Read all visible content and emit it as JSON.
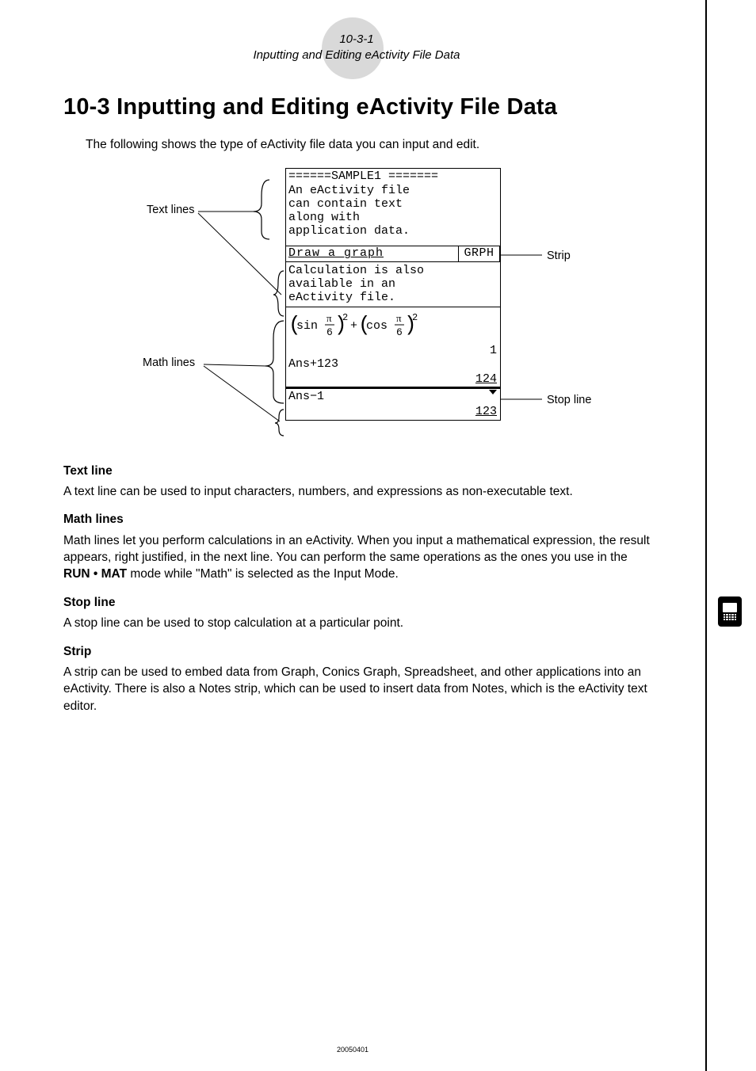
{
  "header": {
    "pageno": "10-3-1",
    "ptitle": "Inputting and Editing eActivity File Data"
  },
  "title": "10-3  Inputting and Editing eActivity File Data",
  "intro": "The following shows the type of eActivity file data you can input and edit.",
  "callouts": {
    "text_lines": "Text lines",
    "math_lines": "Math lines",
    "strip": "Strip",
    "stop_line": "Stop line"
  },
  "screen": {
    "sample_header": "======SAMPLE1 =======",
    "text1": "An eActivity file",
    "text2": "can contain text",
    "text3": "along with",
    "text4": "application data.",
    "strip_label": "Draw a graph",
    "strip_btn": "GRPH",
    "calc1": "Calculation is also",
    "calc2": "available in an",
    "calc3": "eActivity file.",
    "formula": "(sin π⁄6)² + (cos π⁄6)²",
    "result1": "1",
    "line_ans123": "Ans+123",
    "result2": "124",
    "line_ansm1": "Ans−1",
    "result3": "123"
  },
  "sections": {
    "text_line_h": "Text line",
    "text_line_p": "A text line can be used to input characters, numbers, and expressions as non-executable text.",
    "math_lines_h": "Math lines",
    "math_lines_p1": "Math lines let you perform calculations in an eActivity. When you input a mathematical expression, the result appears, right justified, in the next line. You can perform the same operations as the ones you use in the ",
    "math_lines_runmat": "RUN • MAT",
    "math_lines_p2": " mode while \"Math\" is selected as the Input Mode.",
    "stop_line_h": "Stop line",
    "stop_line_p": "A stop line can be used to stop calculation at a particular point.",
    "strip_h": "Strip",
    "strip_p": "A strip can be used to embed data from Graph, Conics Graph, Spreadsheet, and other applications into an eActivity. There is also a Notes strip, which can be used to insert data from Notes, which is the eActivity text editor."
  },
  "footer_date": "20050401"
}
